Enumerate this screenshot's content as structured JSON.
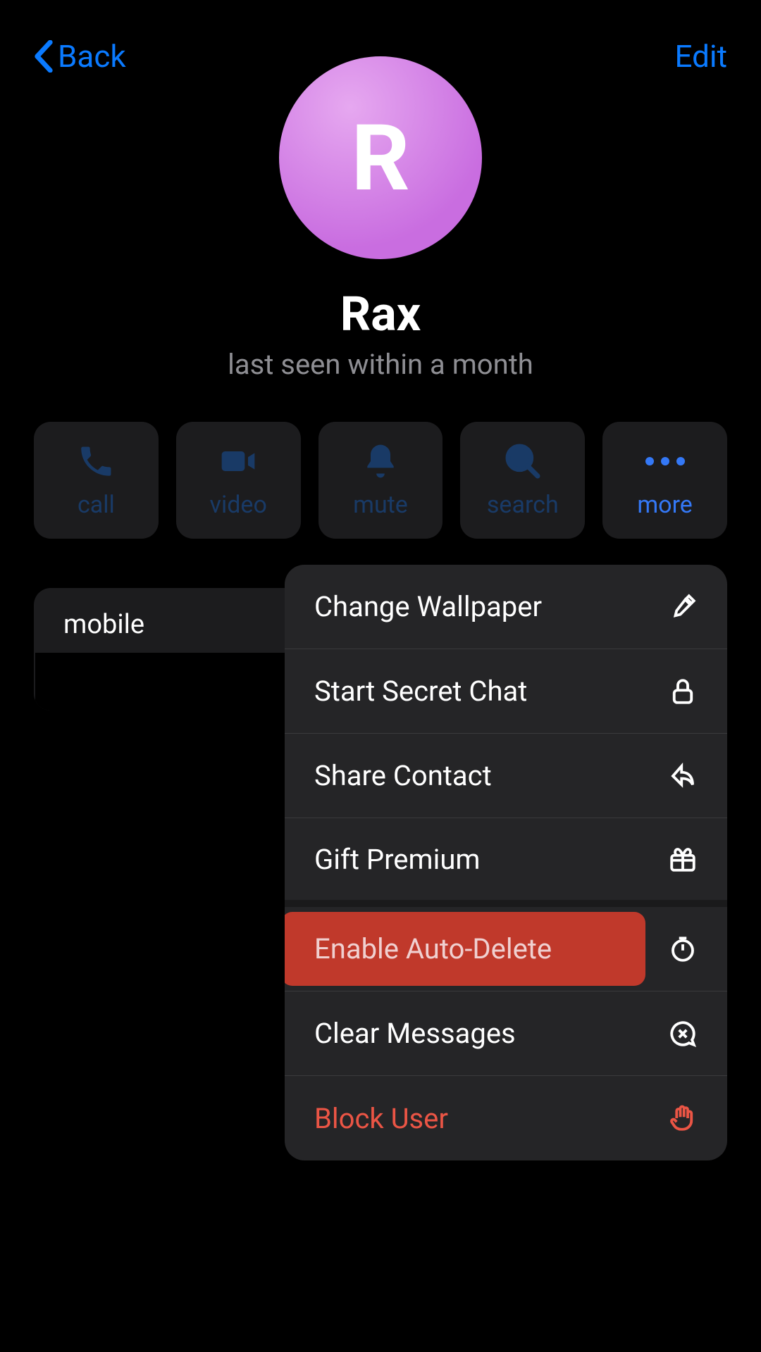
{
  "nav": {
    "back": "Back",
    "edit": "Edit"
  },
  "profile": {
    "initial": "R",
    "name": "Rax",
    "status": "last seen within a month"
  },
  "actions": {
    "call": "call",
    "video": "video",
    "mute": "mute",
    "search": "search",
    "more": "more"
  },
  "info": {
    "mobile_label": "mobile",
    "mobile_value": ""
  },
  "menu": {
    "change_wallpaper": "Change Wallpaper",
    "start_secret_chat": "Start Secret Chat",
    "share_contact": "Share Contact",
    "gift_premium": "Gift Premium",
    "enable_auto_delete": "Enable Auto-Delete",
    "clear_messages": "Clear Messages",
    "block_user": "Block User"
  }
}
